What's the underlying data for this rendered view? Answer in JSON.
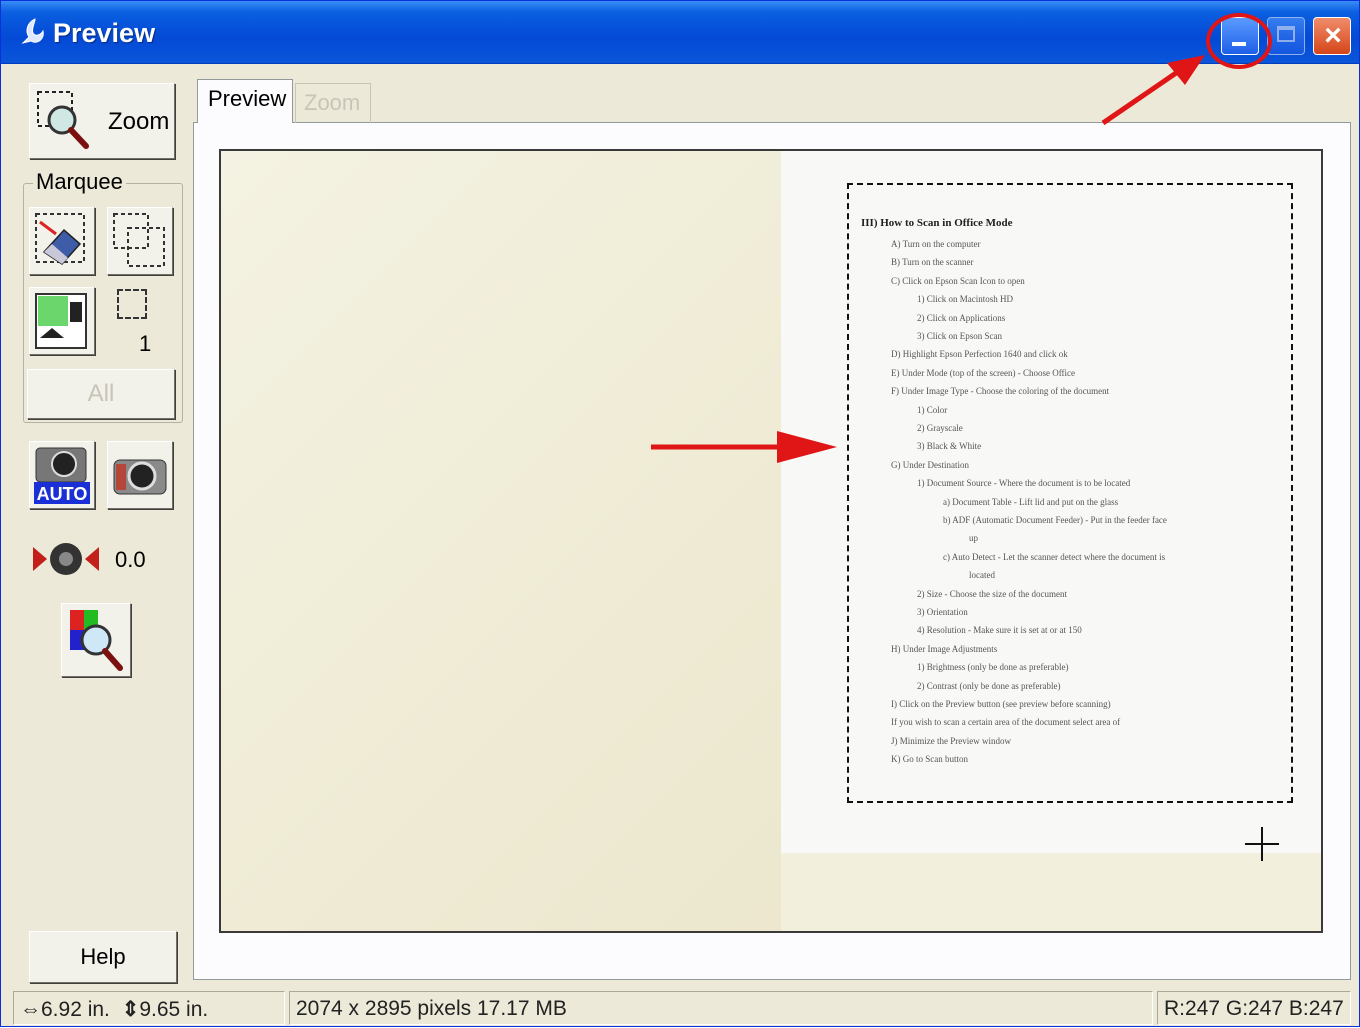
{
  "window": {
    "title": "Preview"
  },
  "toolbar": {
    "zoom_label": "Zoom",
    "marquee_group": "Marquee",
    "marquee_count": "1",
    "all_label": "All",
    "exposure_value": "0.0",
    "help_label": "Help"
  },
  "tabs": [
    {
      "label": "Preview",
      "active": true
    },
    {
      "label": "Zoom",
      "active": false
    }
  ],
  "document": {
    "title": "III) How to Scan in Office Mode",
    "lines": [
      "A)   Turn on the computer",
      "B)   Turn on the scanner",
      "C)   Click on Epson Scan Icon to open",
      "1)   Click on Macintosh HD",
      "2)   Click on Applications",
      "3)   Click on Epson Scan",
      "D)   Highlight Epson Perfection 1640 and click ok",
      "E)   Under Mode (top of the screen) - Choose Office",
      "F)   Under Image Type - Choose the coloring of the document",
      "1)   Color",
      "2)   Grayscale",
      "3)   Black & White",
      "G)   Under Destination",
      "1)   Document Source - Where the document is to be located",
      "a)   Document Table - Lift lid and put on the glass",
      "b)   ADF (Automatic Document Feeder) - Put in the feeder face",
      "up",
      "c)   Auto Detect - Let the scanner detect where the document is",
      "located",
      "2)   Size - Choose the size of the document",
      "3)   Orientation",
      "4)   Resolution - Make sure it is set at or at 150",
      "H)   Under Image Adjustments",
      "1)   Brightness (only be done as preferable)",
      "2)   Contrast (only be done as preferable)",
      "I)   Click on the Preview button (see preview before scanning)",
      "If you wish to scan a certain area of the document select area of",
      "J)   Minimize the Preview window",
      "K)   Go to Scan button"
    ]
  },
  "status": {
    "width": "6.92 in.",
    "height": "9.65 in.",
    "pixels": "2074 x 2895 pixels 17.17 MB",
    "rgb": "R:247 G:247 B:247"
  },
  "colors": {
    "titlebar": "#0449D6",
    "callout_red": "#E01515",
    "window_bg": "#ECE9D8"
  }
}
